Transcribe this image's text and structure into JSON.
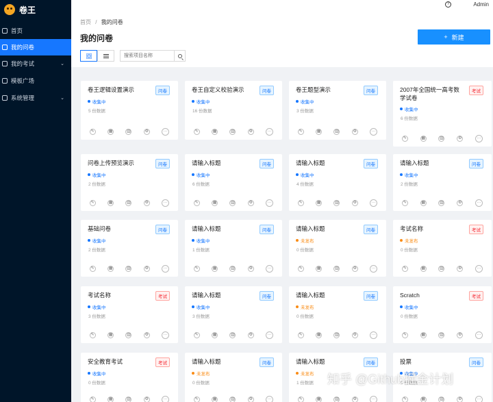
{
  "app": {
    "name": "卷王",
    "help_icon": "help-icon"
  },
  "colors": {
    "sidebar": "#001529",
    "primary": "#1677ff",
    "collecting": "#1677ff",
    "unpublished": "#fa8c16"
  },
  "sidebar": {
    "items": [
      {
        "label": "首页",
        "icon": "home-icon",
        "active": false,
        "has_arrow": false
      },
      {
        "label": "我的问卷",
        "icon": "edit-icon",
        "active": true,
        "has_arrow": false
      },
      {
        "label": "我的考试",
        "icon": "exam-icon",
        "active": false,
        "has_arrow": true
      },
      {
        "label": "模板广场",
        "icon": "template-icon",
        "active": false,
        "has_arrow": false
      },
      {
        "label": "系统管理",
        "icon": "settings-icon",
        "active": false,
        "has_arrow": true
      }
    ]
  },
  "header": {
    "user": "Admin"
  },
  "breadcrumb": {
    "home": "首页",
    "sep": "/",
    "current": "我的问卷"
  },
  "page": {
    "title": "我的问卷",
    "new_button": {
      "plus": "+",
      "label": "新建"
    },
    "search_placeholder": "搜索项目名称"
  },
  "cards": [
    {
      "title": "卷王逻辑设置演示",
      "badge": "问卷",
      "type": "survey",
      "status": "收集中",
      "count": "5 份数据"
    },
    {
      "title": "卷王自定义校验演示",
      "badge": "问卷",
      "type": "survey",
      "status": "收集中",
      "count": "16 份数据"
    },
    {
      "title": "卷王题型演示",
      "badge": "问卷",
      "type": "survey",
      "status": "收集中",
      "count": "3 份数据"
    },
    {
      "title": "2007年全国统一高考数学试卷",
      "badge": "考试",
      "type": "exam",
      "status": "收集中",
      "count": "6 份数据"
    },
    {
      "title": "问卷上传预览演示",
      "badge": "问卷",
      "type": "survey",
      "status": "收集中",
      "count": "2 份数据"
    },
    {
      "title": "请输入标题",
      "badge": "问卷",
      "type": "survey",
      "status": "收集中",
      "count": "6 份数据"
    },
    {
      "title": "请输入标题",
      "badge": "问卷",
      "type": "survey",
      "status": "收集中",
      "count": "4 份数据"
    },
    {
      "title": "请输入标题",
      "badge": "问卷",
      "type": "survey",
      "status": "收集中",
      "count": "2 份数据"
    },
    {
      "title": "基础问卷",
      "badge": "问卷",
      "type": "survey",
      "status": "收集中",
      "count": "2 份数据"
    },
    {
      "title": "请输入标题",
      "badge": "问卷",
      "type": "survey",
      "status": "收集中",
      "count": "1 份数据"
    },
    {
      "title": "请输入标题",
      "badge": "问卷",
      "type": "survey",
      "status": "未发布",
      "count": "0 份数据"
    },
    {
      "title": "考试名称",
      "badge": "考试",
      "type": "exam",
      "status": "未发布",
      "count": "0 份数据"
    },
    {
      "title": "考试名称",
      "badge": "考试",
      "type": "exam",
      "status": "收集中",
      "count": "3 份数据"
    },
    {
      "title": "请输入标题",
      "badge": "问卷",
      "type": "survey",
      "status": "收集中",
      "count": "3 份数据"
    },
    {
      "title": "请输入标题",
      "badge": "问卷",
      "type": "survey",
      "status": "未发布",
      "count": "0 份数据"
    },
    {
      "title": "Scratch",
      "badge": "考试",
      "type": "exam",
      "status": "收集中",
      "count": "0 份数据"
    },
    {
      "title": "安全教育考试",
      "badge": "考试",
      "type": "exam",
      "status": "收集中",
      "count": "0 份数据"
    },
    {
      "title": "请输入标题",
      "badge": "问卷",
      "type": "survey",
      "status": "未发布",
      "count": "0 份数据"
    },
    {
      "title": "请输入标题",
      "badge": "问卷",
      "type": "survey",
      "status": "未发布",
      "count": "1 份数据"
    },
    {
      "title": "投票",
      "badge": "问卷",
      "type": "survey",
      "status": "收集中",
      "count": "0 份数据"
    }
  ],
  "card_actions": [
    "edit-icon",
    "table-icon",
    "chart-icon",
    "settings-icon",
    "more-icon"
  ],
  "watermark": "知乎 @Github掘金计划"
}
